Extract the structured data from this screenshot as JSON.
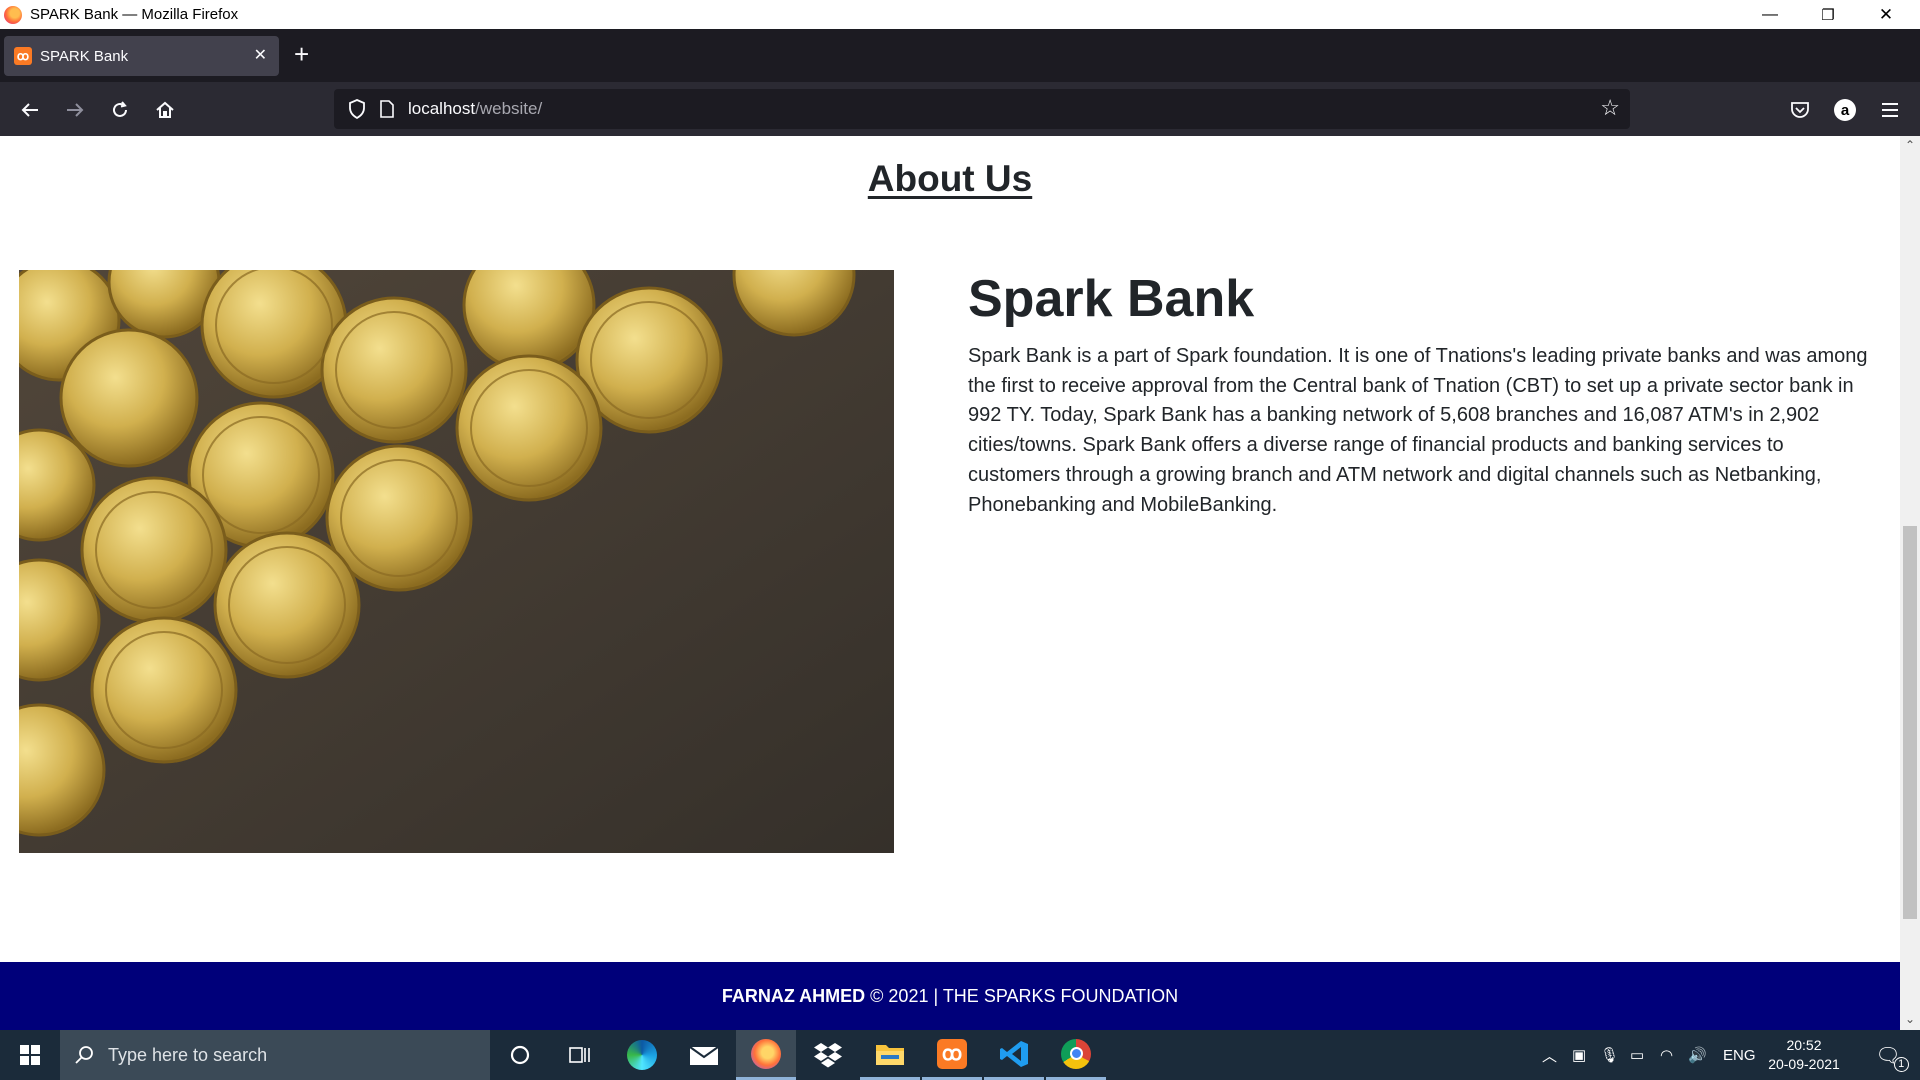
{
  "window": {
    "title": "SPARK Bank — Mozilla Firefox",
    "minimize_glyph": "—",
    "restore_glyph": "❐",
    "close_glyph": "✕"
  },
  "tabs": [
    {
      "label": "SPARK Bank",
      "favicon_text": "ꝏ",
      "active": true
    }
  ],
  "newtab_glyph": "+",
  "tab_close_glyph": "✕",
  "addressbar": {
    "host": "localhost",
    "path": "/website/"
  },
  "page": {
    "about_heading": "About Us",
    "bank_title": "Spark Bank",
    "bank_description": "Spark Bank is a part of Spark foundation. It is one of Tnations's leading private banks and was among the first to receive approval from the Central bank of Tnation (CBT) to set up a private sector bank in 992 TY. Today, Spark Bank has a banking network of 5,608 branches and 16,087 ATM's in 2,902 cities/towns. Spark Bank offers a diverse range of financial products and banking services to customers through a growing branch and ATM network and digital channels such as Netbanking, Phonebanking and MobileBanking.",
    "image_alt": "coins",
    "footer": {
      "name": "FARNAZ AHMED",
      "text": " © 2021 | THE SPARKS FOUNDATION"
    }
  },
  "taskbar": {
    "search_placeholder": "Type here to search",
    "apps": [
      "cortana-icon",
      "task-view-icon",
      "edge-icon",
      "mail-icon",
      "firefox-icon",
      "dropbox-icon",
      "file-explorer-icon",
      "xampp-icon",
      "vscode-icon",
      "chrome-icon"
    ],
    "language": "ENG",
    "time": "20:52",
    "date": "20-09-2021",
    "notification_count": "1"
  },
  "colors": {
    "footer_bg": "#00007a",
    "tab_bar": "#1c1b22",
    "nav_bar": "#2b2a33"
  }
}
